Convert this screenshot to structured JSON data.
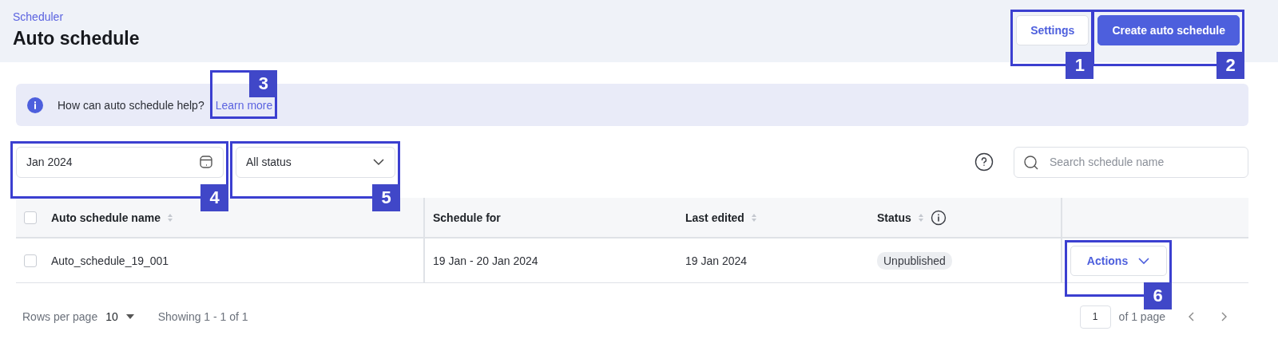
{
  "header": {
    "breadcrumb": "Scheduler",
    "title": "Auto schedule",
    "buttons": [
      {
        "kind": "secondary",
        "label": "Settings",
        "callout": "1"
      },
      {
        "kind": "primary",
        "label": "Create auto schedule",
        "callout": "2"
      }
    ]
  },
  "banner": {
    "text": "How can auto schedule help?",
    "link": "Learn more",
    "link_callout": "3"
  },
  "filters": {
    "date": {
      "value": "Jan 2024",
      "callout": "4"
    },
    "status": {
      "value": "All status",
      "callout": "5"
    },
    "search": {
      "placeholder": "Search schedule name"
    }
  },
  "table": {
    "select_all_checked": false,
    "columns": [
      {
        "label": "Auto schedule name",
        "sortable": true,
        "info": false
      },
      {
        "label": "Schedule for",
        "sortable": false,
        "info": false
      },
      {
        "label": "Last edited",
        "sortable": true,
        "info": false
      },
      {
        "label": "Status",
        "sortable": true,
        "info": true
      }
    ],
    "rows": [
      {
        "checked": false,
        "name": "Auto_schedule_19_001",
        "schedule_for": "19 Jan - 20 Jan 2024",
        "last_edited": "19 Jan 2024",
        "status": "Unpublished",
        "action": "Actions",
        "action_callout": "6"
      }
    ]
  },
  "pagination": {
    "rows_per_page_label": "Rows per page",
    "rows_per_page": "10",
    "showing": "Showing 1 - 1 of 1",
    "page": "1",
    "of_pages": "of 1 page"
  }
}
